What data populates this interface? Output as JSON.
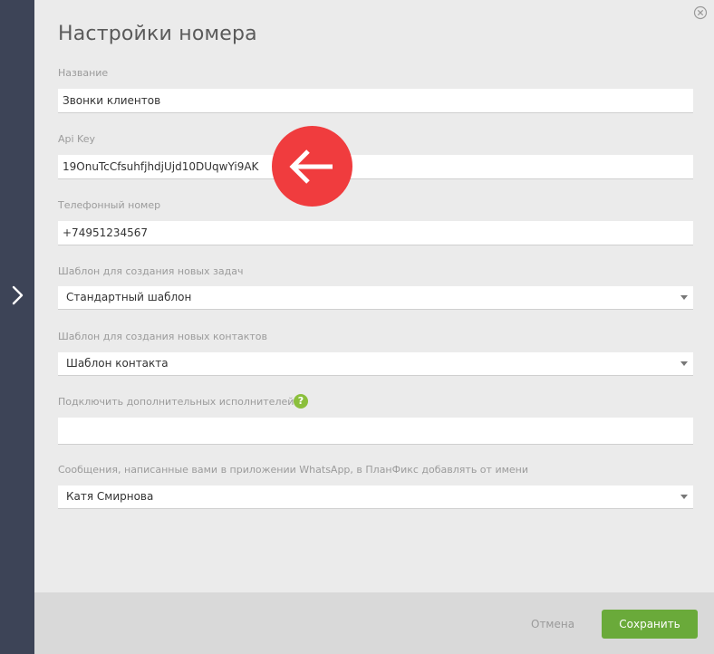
{
  "dialog": {
    "title": "Настройки номера"
  },
  "fields": {
    "name": {
      "label": "Название",
      "value": "Звонки клиентов"
    },
    "api_key": {
      "label": "Api Key",
      "value": "19OnuTcCfsuhfjhdjUjd10DUqwYi9AK"
    },
    "phone": {
      "label": "Телефонный номер",
      "value": "+74951234567"
    },
    "task_template": {
      "label": "Шаблон для создания новых задач",
      "selected": "Стандартный шаблон"
    },
    "contact_template": {
      "label": "Шаблон для создания новых контактов",
      "selected": "Шаблон контакта"
    },
    "extra_assignees": {
      "label": "Подключить дополнительных исполнителей",
      "help_icon": "?"
    },
    "whatsapp_sender": {
      "label": "Сообщения, написанные вами в приложении WhatsApp, в ПланФикс добавлять от имени",
      "selected": "Катя Смирнова"
    }
  },
  "footer": {
    "cancel_label": "Отмена",
    "save_label": "Сохранить"
  },
  "icons": {
    "sidebar": "chevron-right-icon",
    "close": "close-circle-icon",
    "annotation": "arrow-left-icon",
    "help": "question-icon"
  },
  "colors": {
    "sidebar": "#3d4457",
    "save_button": "#6aaa3a",
    "annotation": "#f03c3e",
    "help_badge": "#8bbf3c"
  }
}
